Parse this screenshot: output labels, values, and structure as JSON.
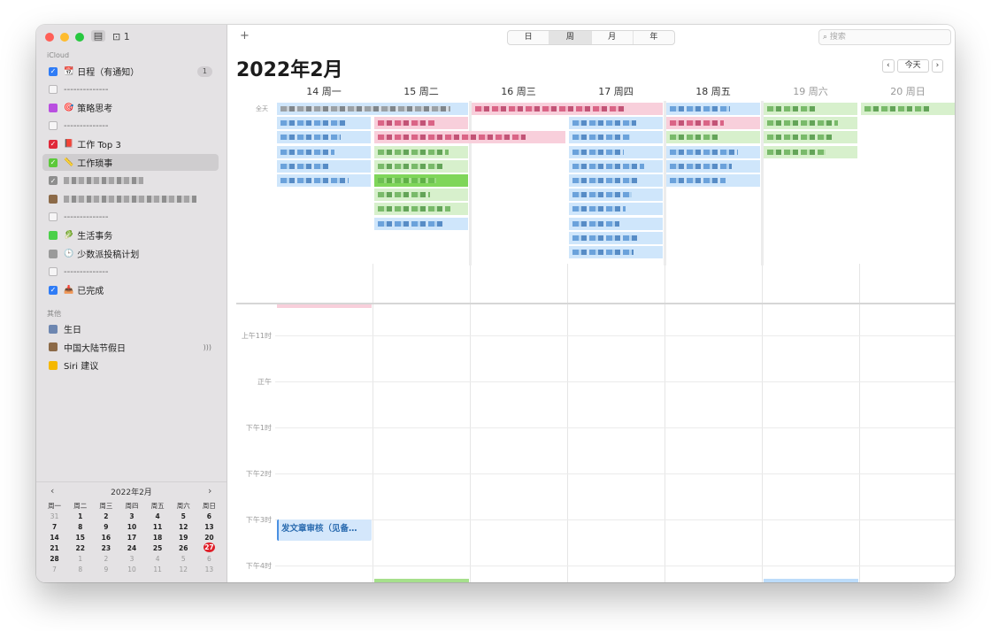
{
  "toolbar": {
    "inbox_count": "1",
    "add_label": "+",
    "view_tabs": [
      "日",
      "周",
      "月",
      "年"
    ],
    "active_view": "周",
    "search_placeholder": "搜索"
  },
  "sidebar": {
    "icloud_label": "iCloud",
    "icloud_items": [
      {
        "label": "日程（有通知）",
        "checked": true,
        "color": "#2f7cf6",
        "emoji": "📆",
        "badge": "1"
      },
      {
        "label": "--------------",
        "checked": false,
        "color": ""
      },
      {
        "label": "策略思考",
        "checked": false,
        "color": "#b94fe0",
        "emoji": "🎯"
      },
      {
        "label": "--------------",
        "checked": false,
        "color": ""
      },
      {
        "label": "工作 Top 3",
        "checked": true,
        "color": "#e0283a",
        "emoji": "📕"
      },
      {
        "label": "工作琐事",
        "checked": true,
        "color": "#5cc93a",
        "emoji": "📏",
        "selected": true
      },
      {
        "label": "",
        "checked": true,
        "color": "#8e8e8e",
        "blurred": true
      },
      {
        "label": "",
        "checked": false,
        "color": "#8c6a48",
        "blurred": true
      },
      {
        "label": "--------------",
        "checked": false,
        "color": ""
      },
      {
        "label": "生活事务",
        "checked": false,
        "color": "#4bd04a",
        "emoji": "🥬"
      },
      {
        "label": "少数派投稿计划",
        "checked": false,
        "color": "#9a9a9a",
        "emoji": "🕒"
      },
      {
        "label": "--------------",
        "checked": false,
        "color": ""
      },
      {
        "label": "已完成",
        "checked": true,
        "color": "#2f7cf6",
        "emoji": "📥"
      }
    ],
    "other_label": "其他",
    "other_items": [
      {
        "label": "生日",
        "color": "#6d86b0"
      },
      {
        "label": "中国大陆节假日",
        "color": "#8c6a48",
        "stream": "◜)))"
      },
      {
        "label": "Siri 建议",
        "color": "#f5b800"
      }
    ]
  },
  "mini_calendar": {
    "title": "2022年2月",
    "prev": "‹",
    "next": "›",
    "weekdays": [
      "周一",
      "周二",
      "周三",
      "周四",
      "周五",
      "周六",
      "周日"
    ],
    "rows": [
      [
        "31",
        "1",
        "2",
        "3",
        "4",
        "5",
        "6"
      ],
      [
        "7",
        "8",
        "9",
        "10",
        "11",
        "12",
        "13"
      ],
      [
        "14",
        "15",
        "16",
        "17",
        "18",
        "19",
        "20"
      ],
      [
        "21",
        "22",
        "23",
        "24",
        "25",
        "26",
        "27"
      ],
      [
        "28",
        "1",
        "2",
        "3",
        "4",
        "5",
        "6"
      ],
      [
        "7",
        "8",
        "9",
        "10",
        "11",
        "12",
        "13"
      ]
    ],
    "today": "27"
  },
  "main": {
    "title": "2022年2月",
    "prev": "‹",
    "today_button": "今天",
    "next": "›",
    "days": [
      "14 周一",
      "15 周二",
      "16 周三",
      "17 周四",
      "18 周五",
      "19 周六",
      "20 周日"
    ],
    "allday_label": "全天",
    "time_labels": [
      "上午11时",
      "正午",
      "下午1时",
      "下午2时",
      "下午3时",
      "下午4时"
    ],
    "event_title": "发文章审核（见备…"
  },
  "colors": {
    "accent": "#2f7cf6",
    "today_red": "#e0202a"
  }
}
